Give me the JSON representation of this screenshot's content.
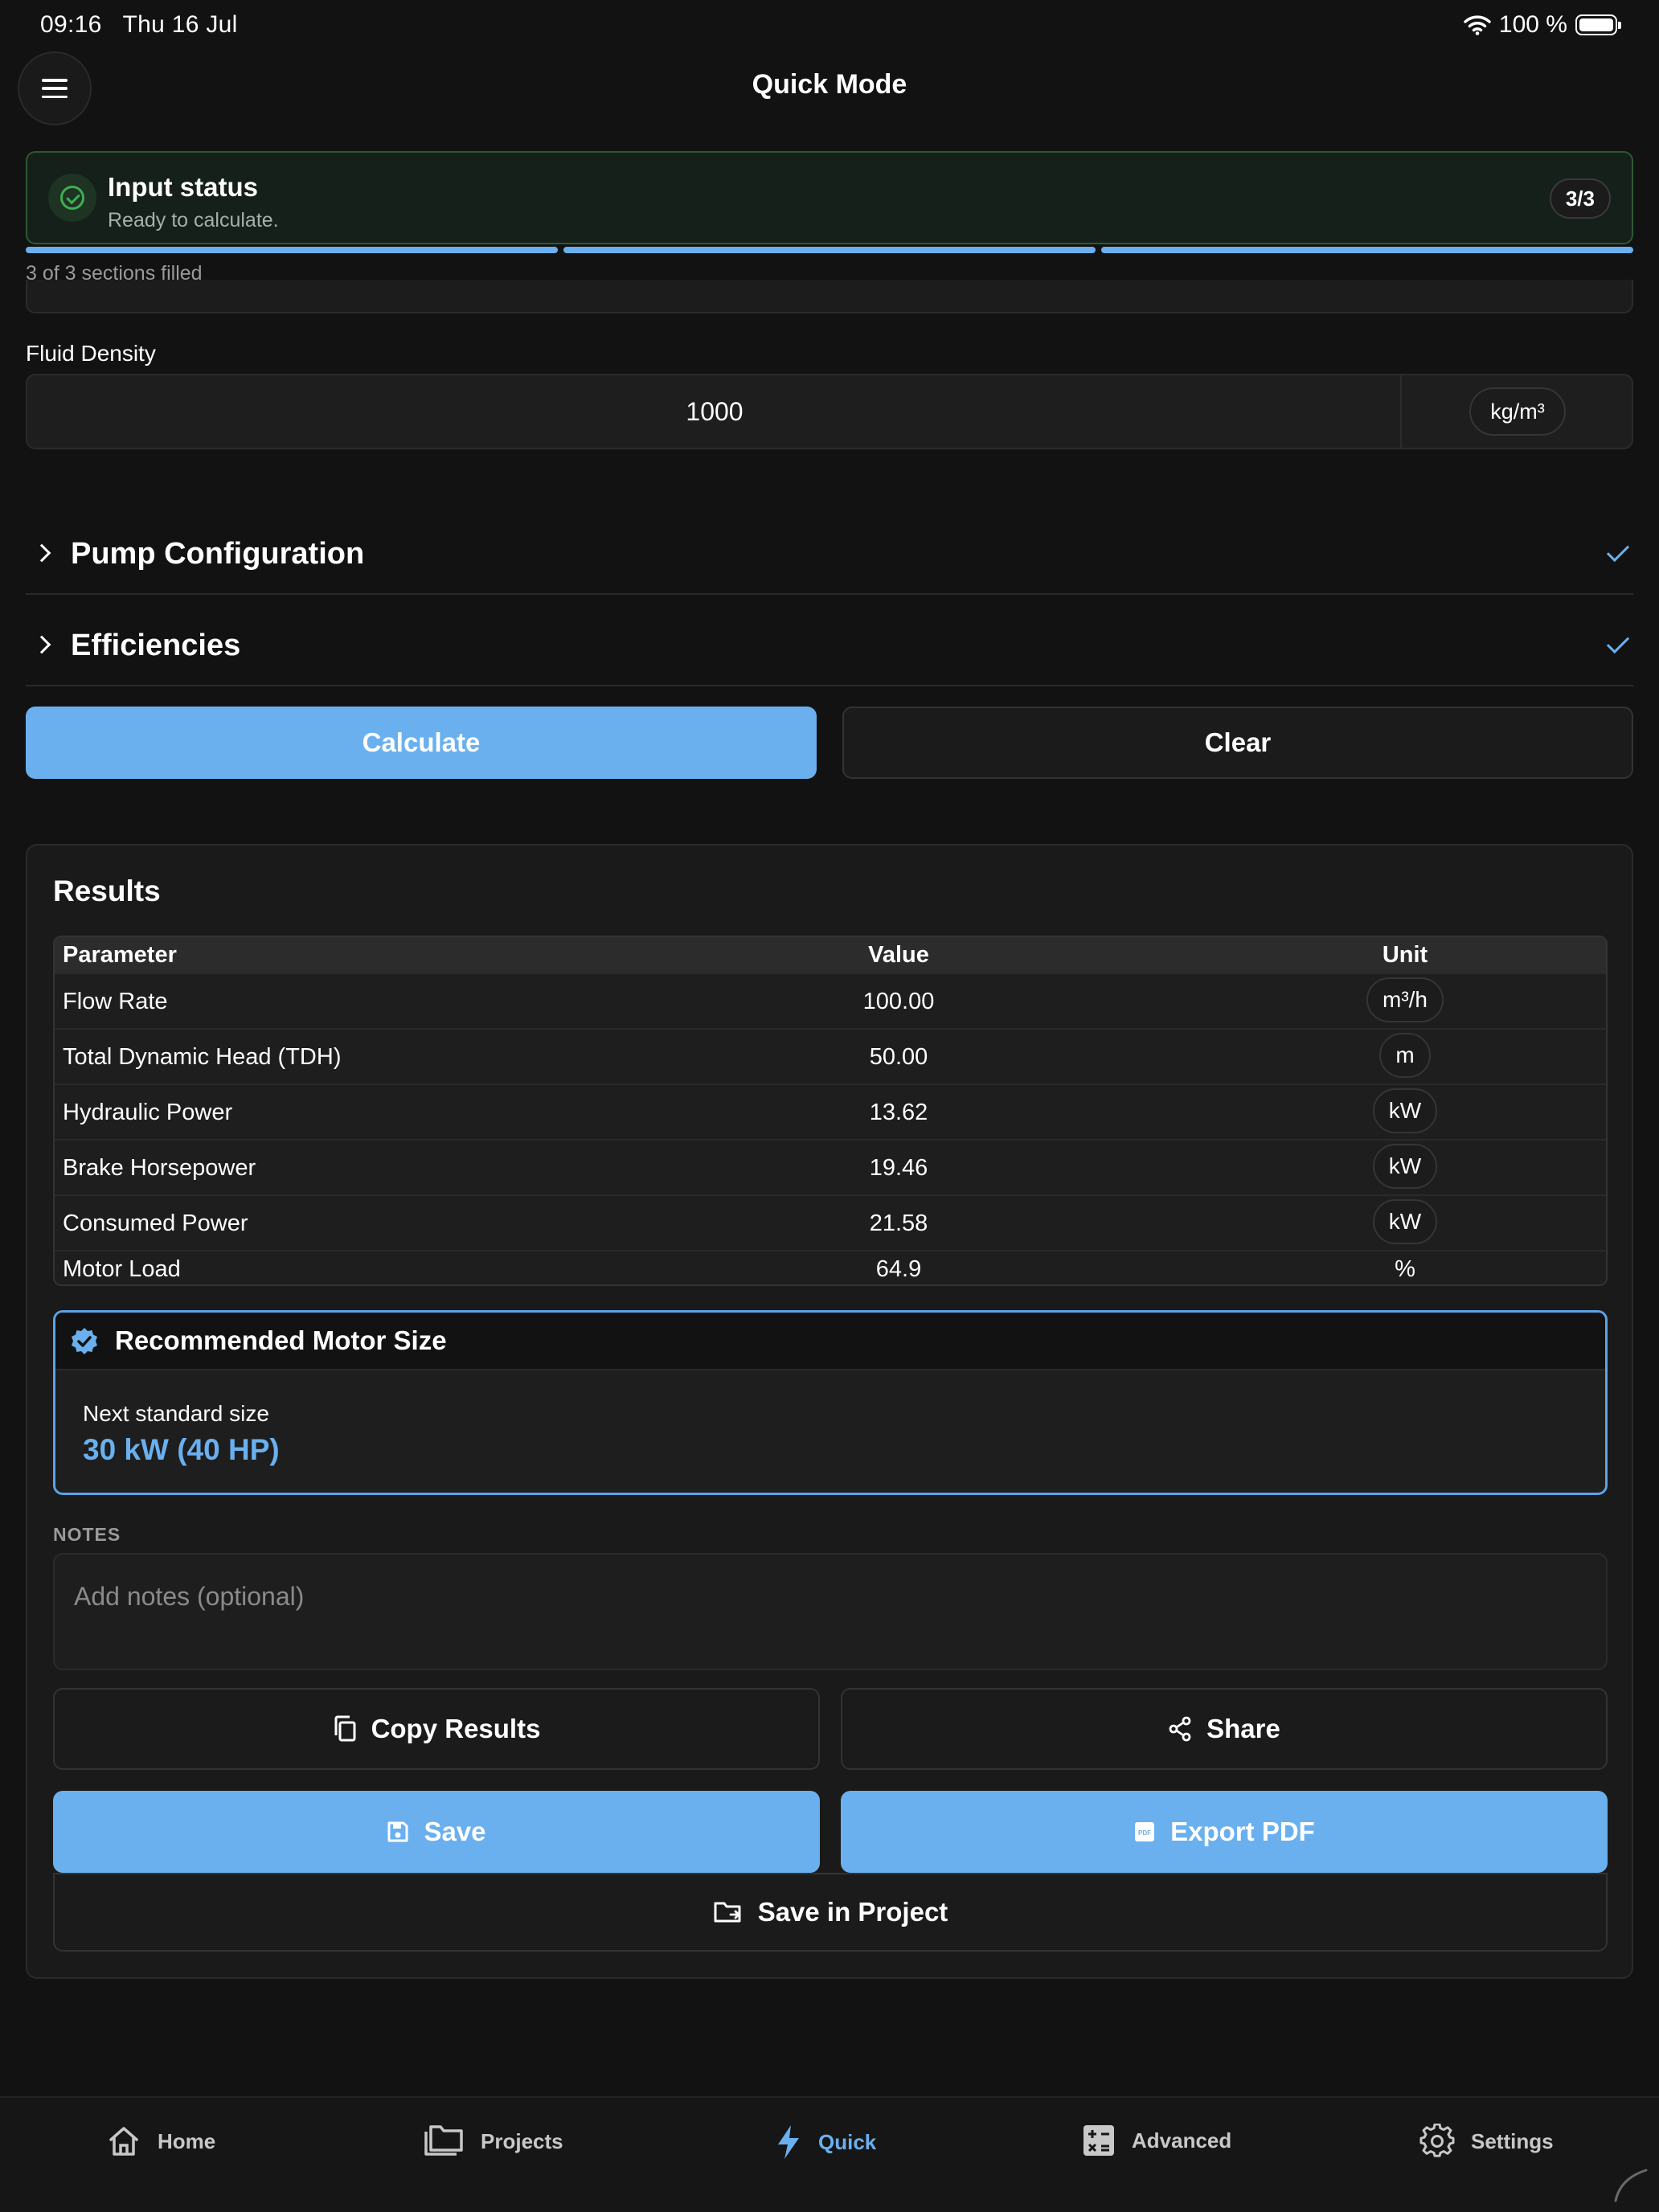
{
  "status_bar": {
    "time": "09:16",
    "date": "Thu 16 Jul",
    "battery": "100 %"
  },
  "header": {
    "title": "Quick Mode"
  },
  "input_status": {
    "title": "Input status",
    "subtitle": "Ready to calculate.",
    "count": "3/3",
    "progress_caption": "3 of 3 sections filled",
    "sections_total": 3,
    "sections_filled": 3
  },
  "fluid_density": {
    "label": "Fluid Density",
    "value": "1000",
    "unit": "kg/m³"
  },
  "accordions": [
    {
      "label": "Pump Configuration",
      "complete": true
    },
    {
      "label": "Efficiencies",
      "complete": true
    }
  ],
  "actions": {
    "calculate": "Calculate",
    "clear": "Clear"
  },
  "results": {
    "title": "Results",
    "columns": [
      "Parameter",
      "Value",
      "Unit"
    ],
    "rows": [
      {
        "param": "Flow Rate",
        "value": "100.00",
        "unit": "m³/h"
      },
      {
        "param": "Total Dynamic Head (TDH)",
        "value": "50.00",
        "unit": "m"
      },
      {
        "param": "Hydraulic Power",
        "value": "13.62",
        "unit": "kW"
      },
      {
        "param": "Brake Horsepower",
        "value": "19.46",
        "unit": "kW"
      },
      {
        "param": "Consumed Power",
        "value": "21.58",
        "unit": "kW"
      },
      {
        "param": "Motor Load",
        "value": "64.9",
        "unit": "%"
      }
    ],
    "recommended": {
      "title": "Recommended Motor Size",
      "label": "Next standard size",
      "value": "30 kW (40 HP)"
    },
    "notes": {
      "label": "NOTES",
      "placeholder": "Add notes (optional)"
    },
    "buttons": {
      "copy": "Copy Results",
      "share": "Share",
      "save": "Save",
      "export": "Export PDF",
      "save_project": "Save in Project"
    }
  },
  "tabbar": {
    "items": [
      {
        "label": "Home",
        "icon": "home-icon"
      },
      {
        "label": "Projects",
        "icon": "folders-icon"
      },
      {
        "label": "Quick",
        "icon": "lightning-icon",
        "active": true
      },
      {
        "label": "Advanced",
        "icon": "calculator-icon"
      },
      {
        "label": "Settings",
        "icon": "gear-icon"
      }
    ]
  },
  "colors": {
    "accent": "#6ab0ef",
    "success": "#3fae52",
    "background": "#121212",
    "surface": "#1a1a1a"
  }
}
